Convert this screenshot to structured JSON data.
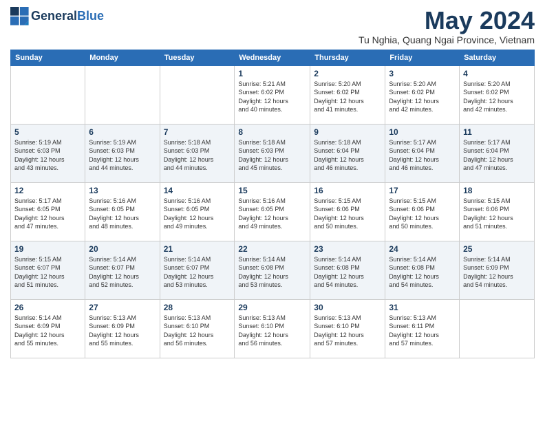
{
  "header": {
    "logo_line1": "General",
    "logo_line2": "Blue",
    "month_year": "May 2024",
    "location": "Tu Nghia, Quang Ngai Province, Vietnam"
  },
  "days_of_week": [
    "Sunday",
    "Monday",
    "Tuesday",
    "Wednesday",
    "Thursday",
    "Friday",
    "Saturday"
  ],
  "weeks": [
    [
      {
        "num": "",
        "info": ""
      },
      {
        "num": "",
        "info": ""
      },
      {
        "num": "",
        "info": ""
      },
      {
        "num": "1",
        "info": "Sunrise: 5:21 AM\nSunset: 6:02 PM\nDaylight: 12 hours\nand 40 minutes."
      },
      {
        "num": "2",
        "info": "Sunrise: 5:20 AM\nSunset: 6:02 PM\nDaylight: 12 hours\nand 41 minutes."
      },
      {
        "num": "3",
        "info": "Sunrise: 5:20 AM\nSunset: 6:02 PM\nDaylight: 12 hours\nand 42 minutes."
      },
      {
        "num": "4",
        "info": "Sunrise: 5:20 AM\nSunset: 6:02 PM\nDaylight: 12 hours\nand 42 minutes."
      }
    ],
    [
      {
        "num": "5",
        "info": "Sunrise: 5:19 AM\nSunset: 6:03 PM\nDaylight: 12 hours\nand 43 minutes."
      },
      {
        "num": "6",
        "info": "Sunrise: 5:19 AM\nSunset: 6:03 PM\nDaylight: 12 hours\nand 44 minutes."
      },
      {
        "num": "7",
        "info": "Sunrise: 5:18 AM\nSunset: 6:03 PM\nDaylight: 12 hours\nand 44 minutes."
      },
      {
        "num": "8",
        "info": "Sunrise: 5:18 AM\nSunset: 6:03 PM\nDaylight: 12 hours\nand 45 minutes."
      },
      {
        "num": "9",
        "info": "Sunrise: 5:18 AM\nSunset: 6:04 PM\nDaylight: 12 hours\nand 46 minutes."
      },
      {
        "num": "10",
        "info": "Sunrise: 5:17 AM\nSunset: 6:04 PM\nDaylight: 12 hours\nand 46 minutes."
      },
      {
        "num": "11",
        "info": "Sunrise: 5:17 AM\nSunset: 6:04 PM\nDaylight: 12 hours\nand 47 minutes."
      }
    ],
    [
      {
        "num": "12",
        "info": "Sunrise: 5:17 AM\nSunset: 6:05 PM\nDaylight: 12 hours\nand 47 minutes."
      },
      {
        "num": "13",
        "info": "Sunrise: 5:16 AM\nSunset: 6:05 PM\nDaylight: 12 hours\nand 48 minutes."
      },
      {
        "num": "14",
        "info": "Sunrise: 5:16 AM\nSunset: 6:05 PM\nDaylight: 12 hours\nand 49 minutes."
      },
      {
        "num": "15",
        "info": "Sunrise: 5:16 AM\nSunset: 6:05 PM\nDaylight: 12 hours\nand 49 minutes."
      },
      {
        "num": "16",
        "info": "Sunrise: 5:15 AM\nSunset: 6:06 PM\nDaylight: 12 hours\nand 50 minutes."
      },
      {
        "num": "17",
        "info": "Sunrise: 5:15 AM\nSunset: 6:06 PM\nDaylight: 12 hours\nand 50 minutes."
      },
      {
        "num": "18",
        "info": "Sunrise: 5:15 AM\nSunset: 6:06 PM\nDaylight: 12 hours\nand 51 minutes."
      }
    ],
    [
      {
        "num": "19",
        "info": "Sunrise: 5:15 AM\nSunset: 6:07 PM\nDaylight: 12 hours\nand 51 minutes."
      },
      {
        "num": "20",
        "info": "Sunrise: 5:14 AM\nSunset: 6:07 PM\nDaylight: 12 hours\nand 52 minutes."
      },
      {
        "num": "21",
        "info": "Sunrise: 5:14 AM\nSunset: 6:07 PM\nDaylight: 12 hours\nand 53 minutes."
      },
      {
        "num": "22",
        "info": "Sunrise: 5:14 AM\nSunset: 6:08 PM\nDaylight: 12 hours\nand 53 minutes."
      },
      {
        "num": "23",
        "info": "Sunrise: 5:14 AM\nSunset: 6:08 PM\nDaylight: 12 hours\nand 54 minutes."
      },
      {
        "num": "24",
        "info": "Sunrise: 5:14 AM\nSunset: 6:08 PM\nDaylight: 12 hours\nand 54 minutes."
      },
      {
        "num": "25",
        "info": "Sunrise: 5:14 AM\nSunset: 6:09 PM\nDaylight: 12 hours\nand 54 minutes."
      }
    ],
    [
      {
        "num": "26",
        "info": "Sunrise: 5:14 AM\nSunset: 6:09 PM\nDaylight: 12 hours\nand 55 minutes."
      },
      {
        "num": "27",
        "info": "Sunrise: 5:13 AM\nSunset: 6:09 PM\nDaylight: 12 hours\nand 55 minutes."
      },
      {
        "num": "28",
        "info": "Sunrise: 5:13 AM\nSunset: 6:10 PM\nDaylight: 12 hours\nand 56 minutes."
      },
      {
        "num": "29",
        "info": "Sunrise: 5:13 AM\nSunset: 6:10 PM\nDaylight: 12 hours\nand 56 minutes."
      },
      {
        "num": "30",
        "info": "Sunrise: 5:13 AM\nSunset: 6:10 PM\nDaylight: 12 hours\nand 57 minutes."
      },
      {
        "num": "31",
        "info": "Sunrise: 5:13 AM\nSunset: 6:11 PM\nDaylight: 12 hours\nand 57 minutes."
      },
      {
        "num": "",
        "info": ""
      }
    ]
  ]
}
